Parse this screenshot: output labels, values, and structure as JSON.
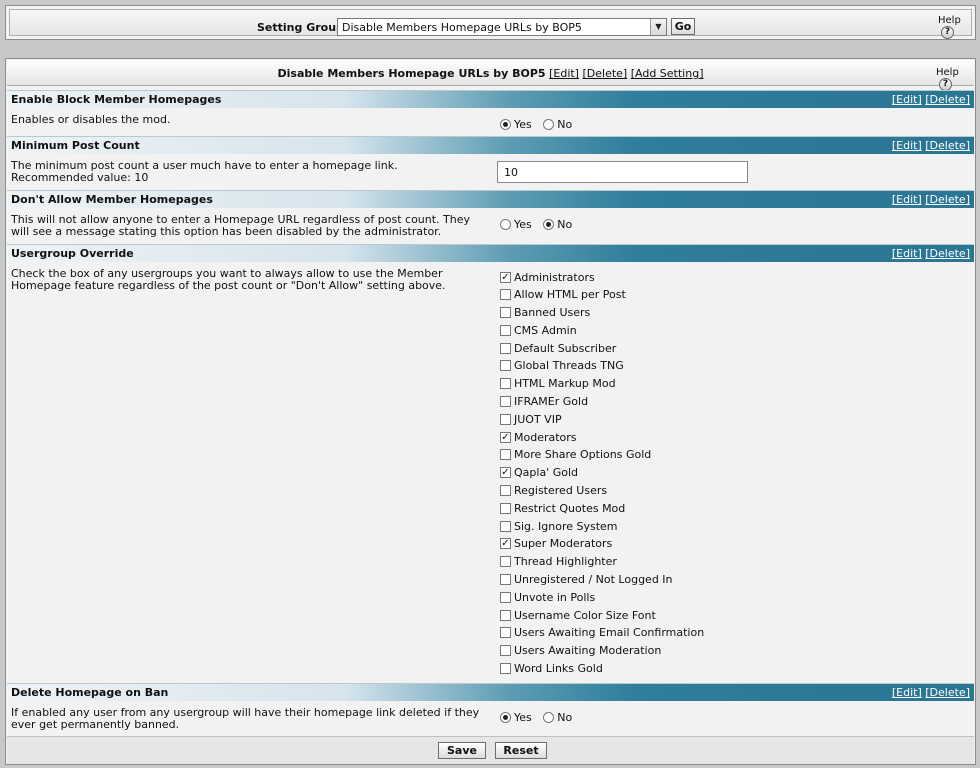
{
  "top": {
    "setting_group_label": "Setting Group",
    "selected_group": "Disable Members Homepage URLs by BOP5",
    "go_label": "Go",
    "help_label": "Help"
  },
  "panel": {
    "title": "Disable Members Homepage URLs by BOP5",
    "edit": "[Edit]",
    "delete": "[Delete]",
    "add": "[Add Setting]",
    "help_label": "Help"
  },
  "sections": [
    {
      "name": "Enable Block Member Homepages",
      "edit": "[Edit]",
      "delete": "[Delete]",
      "description": "Enables or disables the mod.",
      "yes": "Yes",
      "no": "No",
      "value": "Yes"
    },
    {
      "name": "Minimum Post Count",
      "edit": "[Edit]",
      "delete": "[Delete]",
      "description": "The minimum post count a user much have to enter a homepage link.",
      "recommended": "Recommended value: 10",
      "value": "10"
    },
    {
      "name": "Don't Allow Member Homepages",
      "edit": "[Edit]",
      "delete": "[Delete]",
      "description": "This will not allow anyone to enter a Homepage URL regardless of post count. They will see a message stating this option has been disabled by the administrator.",
      "yes": "Yes",
      "no": "No",
      "value": "No"
    },
    {
      "name": "Usergroup Override",
      "edit": "[Edit]",
      "delete": "[Delete]",
      "description": "Check the box of any usergroups you want to always allow to use the Member Homepage feature regardless of the post count or \"Don't Allow\" setting above.",
      "groups": [
        {
          "label": "Administrators",
          "checked": true
        },
        {
          "label": "Allow HTML per Post",
          "checked": false
        },
        {
          "label": "Banned Users",
          "checked": false
        },
        {
          "label": "CMS Admin",
          "checked": false
        },
        {
          "label": "Default Subscriber",
          "checked": false
        },
        {
          "label": "Global Threads TNG",
          "checked": false
        },
        {
          "label": "HTML Markup Mod",
          "checked": false
        },
        {
          "label": "IFRAMEr Gold",
          "checked": false
        },
        {
          "label": "JUOT VIP",
          "checked": false
        },
        {
          "label": "Moderators",
          "checked": true
        },
        {
          "label": "More Share Options Gold",
          "checked": false
        },
        {
          "label": "Qapla' Gold",
          "checked": true
        },
        {
          "label": "Registered Users",
          "checked": false
        },
        {
          "label": "Restrict Quotes Mod",
          "checked": false
        },
        {
          "label": "Sig. Ignore System",
          "checked": false
        },
        {
          "label": "Super Moderators",
          "checked": true
        },
        {
          "label": "Thread Highlighter",
          "checked": false
        },
        {
          "label": "Unregistered / Not Logged In",
          "checked": false
        },
        {
          "label": "Unvote in Polls",
          "checked": false
        },
        {
          "label": "Username Color Size Font",
          "checked": false
        },
        {
          "label": "Users Awaiting Email Confirmation",
          "checked": false
        },
        {
          "label": "Users Awaiting Moderation",
          "checked": false
        },
        {
          "label": "Word Links Gold",
          "checked": false
        }
      ]
    },
    {
      "name": "Delete Homepage on Ban",
      "edit": "[Edit]",
      "delete": "[Delete]",
      "description": "If enabled any user from any usergroup will have their homepage link deleted if they ever get permanently banned.",
      "yes": "Yes",
      "no": "No",
      "value": "Yes"
    }
  ],
  "footer": {
    "save_label": "Save",
    "reset_label": "Reset"
  },
  "icons": {
    "help": "help-icon",
    "dropdown": "chevron-down-icon",
    "check": "checkmark-icon"
  }
}
